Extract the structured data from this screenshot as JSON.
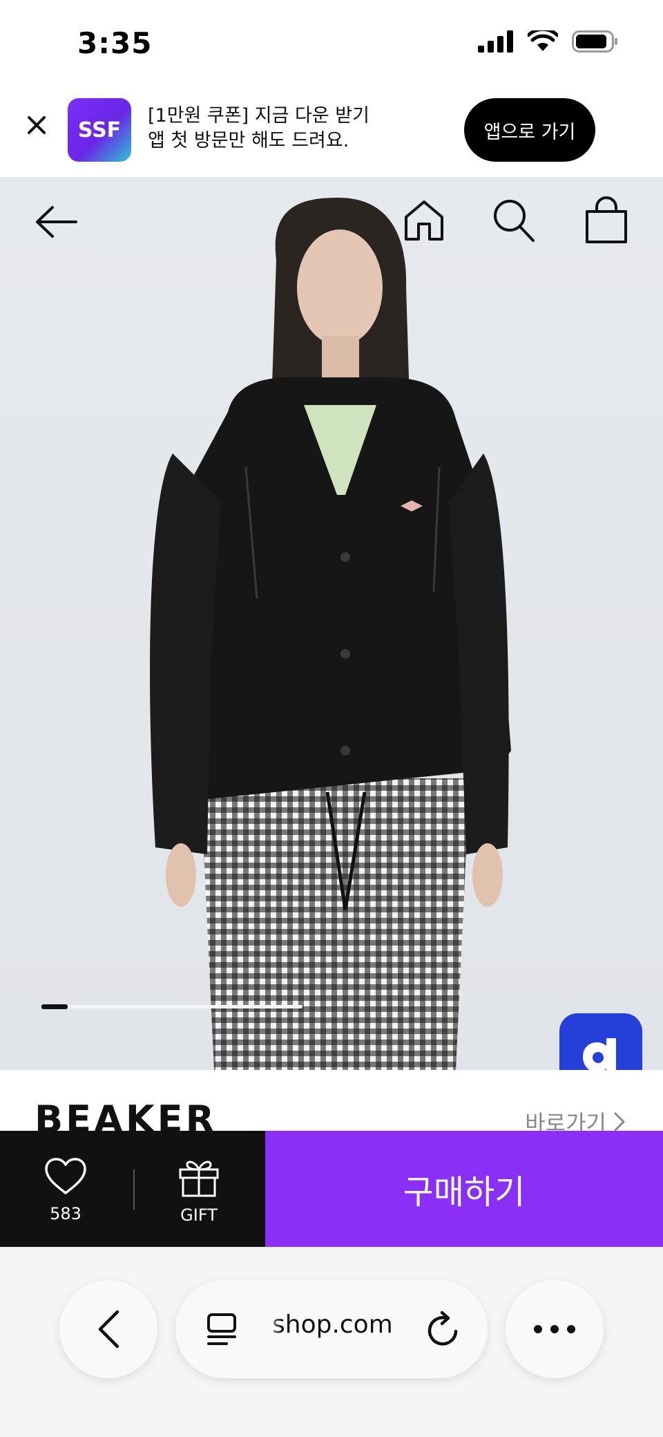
{
  "status_bar": {
    "time": "3:35"
  },
  "app_banner": {
    "close_icon": "close-icon",
    "logo_text": "SSF",
    "line1": "[1만원 쿠폰] 지금 다운 받기",
    "line2": "앱 첫 방문만 해도 드려요.",
    "cta_label": "앱으로 가기",
    "logo_gradient": [
      "#7b2ff7",
      "#2ec4d6"
    ]
  },
  "product_nav": {
    "back_icon": "arrow-left-icon",
    "home_icon": "home-icon",
    "search_icon": "search-icon",
    "cart_icon": "shopping-bag-icon"
  },
  "image_pager": {
    "current": 1,
    "progress": 0.1
  },
  "floating_button": {
    "icon": "d-logo-icon",
    "color": "#2540d9"
  },
  "brand": {
    "name": "BEAKER",
    "link_label": "바로가기"
  },
  "purchase_bar": {
    "like_count": "583",
    "gift_label": "GIFT",
    "buy_label": "구매하기",
    "buy_color": "#8a2ff5"
  },
  "browser": {
    "url": "shop.com",
    "back_icon": "chevron-left-icon",
    "tabs_icon": "tabs-icon",
    "reload_icon": "reload-icon",
    "more_icon": "more-dots-icon"
  }
}
